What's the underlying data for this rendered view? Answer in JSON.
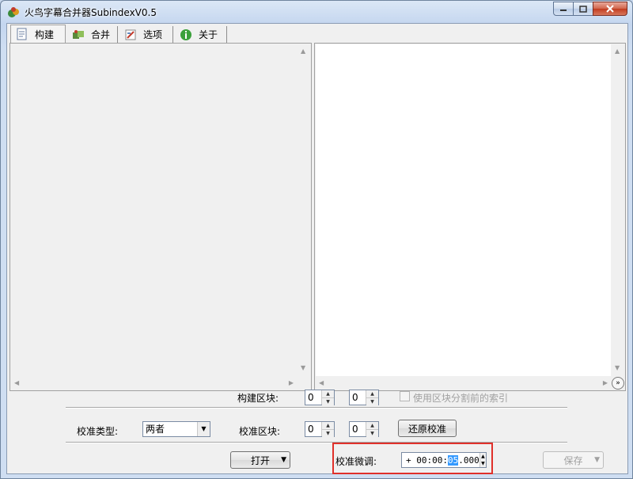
{
  "window": {
    "title": "火鸟字幕合并器SubindexV0.5"
  },
  "tabs": [
    {
      "label": "构建",
      "icon": "build-icon"
    },
    {
      "label": "合并",
      "icon": "merge-icon"
    },
    {
      "label": "选项",
      "icon": "options-icon"
    },
    {
      "label": "关于",
      "icon": "about-icon"
    }
  ],
  "controls": {
    "build_block_label": "构建区块:",
    "build_block_a": "0",
    "build_block_b": "0",
    "use_split_index_label": "使用区块分割前的索引",
    "calib_type_label": "校准类型:",
    "calib_type_value": "两者",
    "calib_block_label": "校准区块:",
    "calib_block_a": "0",
    "calib_block_b": "0",
    "restore_calib_button": "还原校准",
    "open_button": "打开",
    "calib_fine_label": "校准微调:",
    "calib_fine_sign": "+",
    "calib_fine_prefix": "00:00:",
    "calib_fine_selected": "05",
    "calib_fine_suffix": ".000",
    "save_button": "保存"
  },
  "colors": {
    "highlight": "#e0302a",
    "selection": "#3399ff"
  }
}
